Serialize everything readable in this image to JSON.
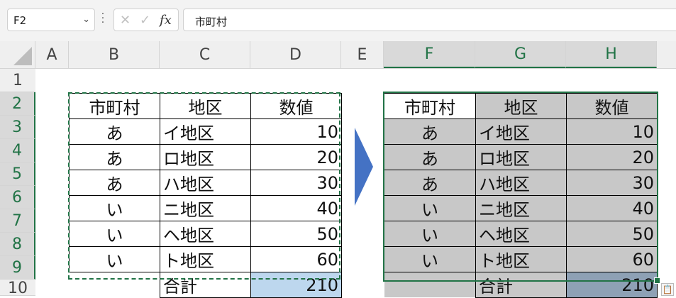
{
  "namebox": {
    "value": "F2"
  },
  "formula_bar": {
    "value": "市町村",
    "fx_label": "fx"
  },
  "columns": [
    "A",
    "B",
    "C",
    "D",
    "E",
    "F",
    "G",
    "H"
  ],
  "rows": [
    "1",
    "2",
    "3",
    "4",
    "5",
    "6",
    "7",
    "8",
    "9",
    "10"
  ],
  "left_table": {
    "headers": [
      "市町村",
      "地区",
      "数値"
    ],
    "rows": [
      [
        "あ",
        "イ地区",
        "10"
      ],
      [
        "あ",
        "ロ地区",
        "20"
      ],
      [
        "あ",
        "ハ地区",
        "30"
      ],
      [
        "い",
        "ニ地区",
        "40"
      ],
      [
        "い",
        "ヘ地区",
        "50"
      ],
      [
        "い",
        "ト地区",
        "60"
      ],
      [
        "",
        "合計",
        "210"
      ]
    ]
  },
  "right_table": {
    "headers": [
      "市町村",
      "地区",
      "数値"
    ],
    "rows": [
      [
        "あ",
        "イ地区",
        "10"
      ],
      [
        "あ",
        "ロ地区",
        "20"
      ],
      [
        "あ",
        "ハ地区",
        "30"
      ],
      [
        "い",
        "ニ地区",
        "40"
      ],
      [
        "い",
        "ヘ地区",
        "50"
      ],
      [
        "い",
        "ト地区",
        "60"
      ],
      [
        "",
        "合計",
        "210"
      ]
    ]
  },
  "colors": {
    "selection": "#217346",
    "left_total_fill": "#bdd7ee",
    "right_fill": "#c8c8c8",
    "right_total_fill": "#8ea1b5",
    "arrow": "#4472c4"
  }
}
